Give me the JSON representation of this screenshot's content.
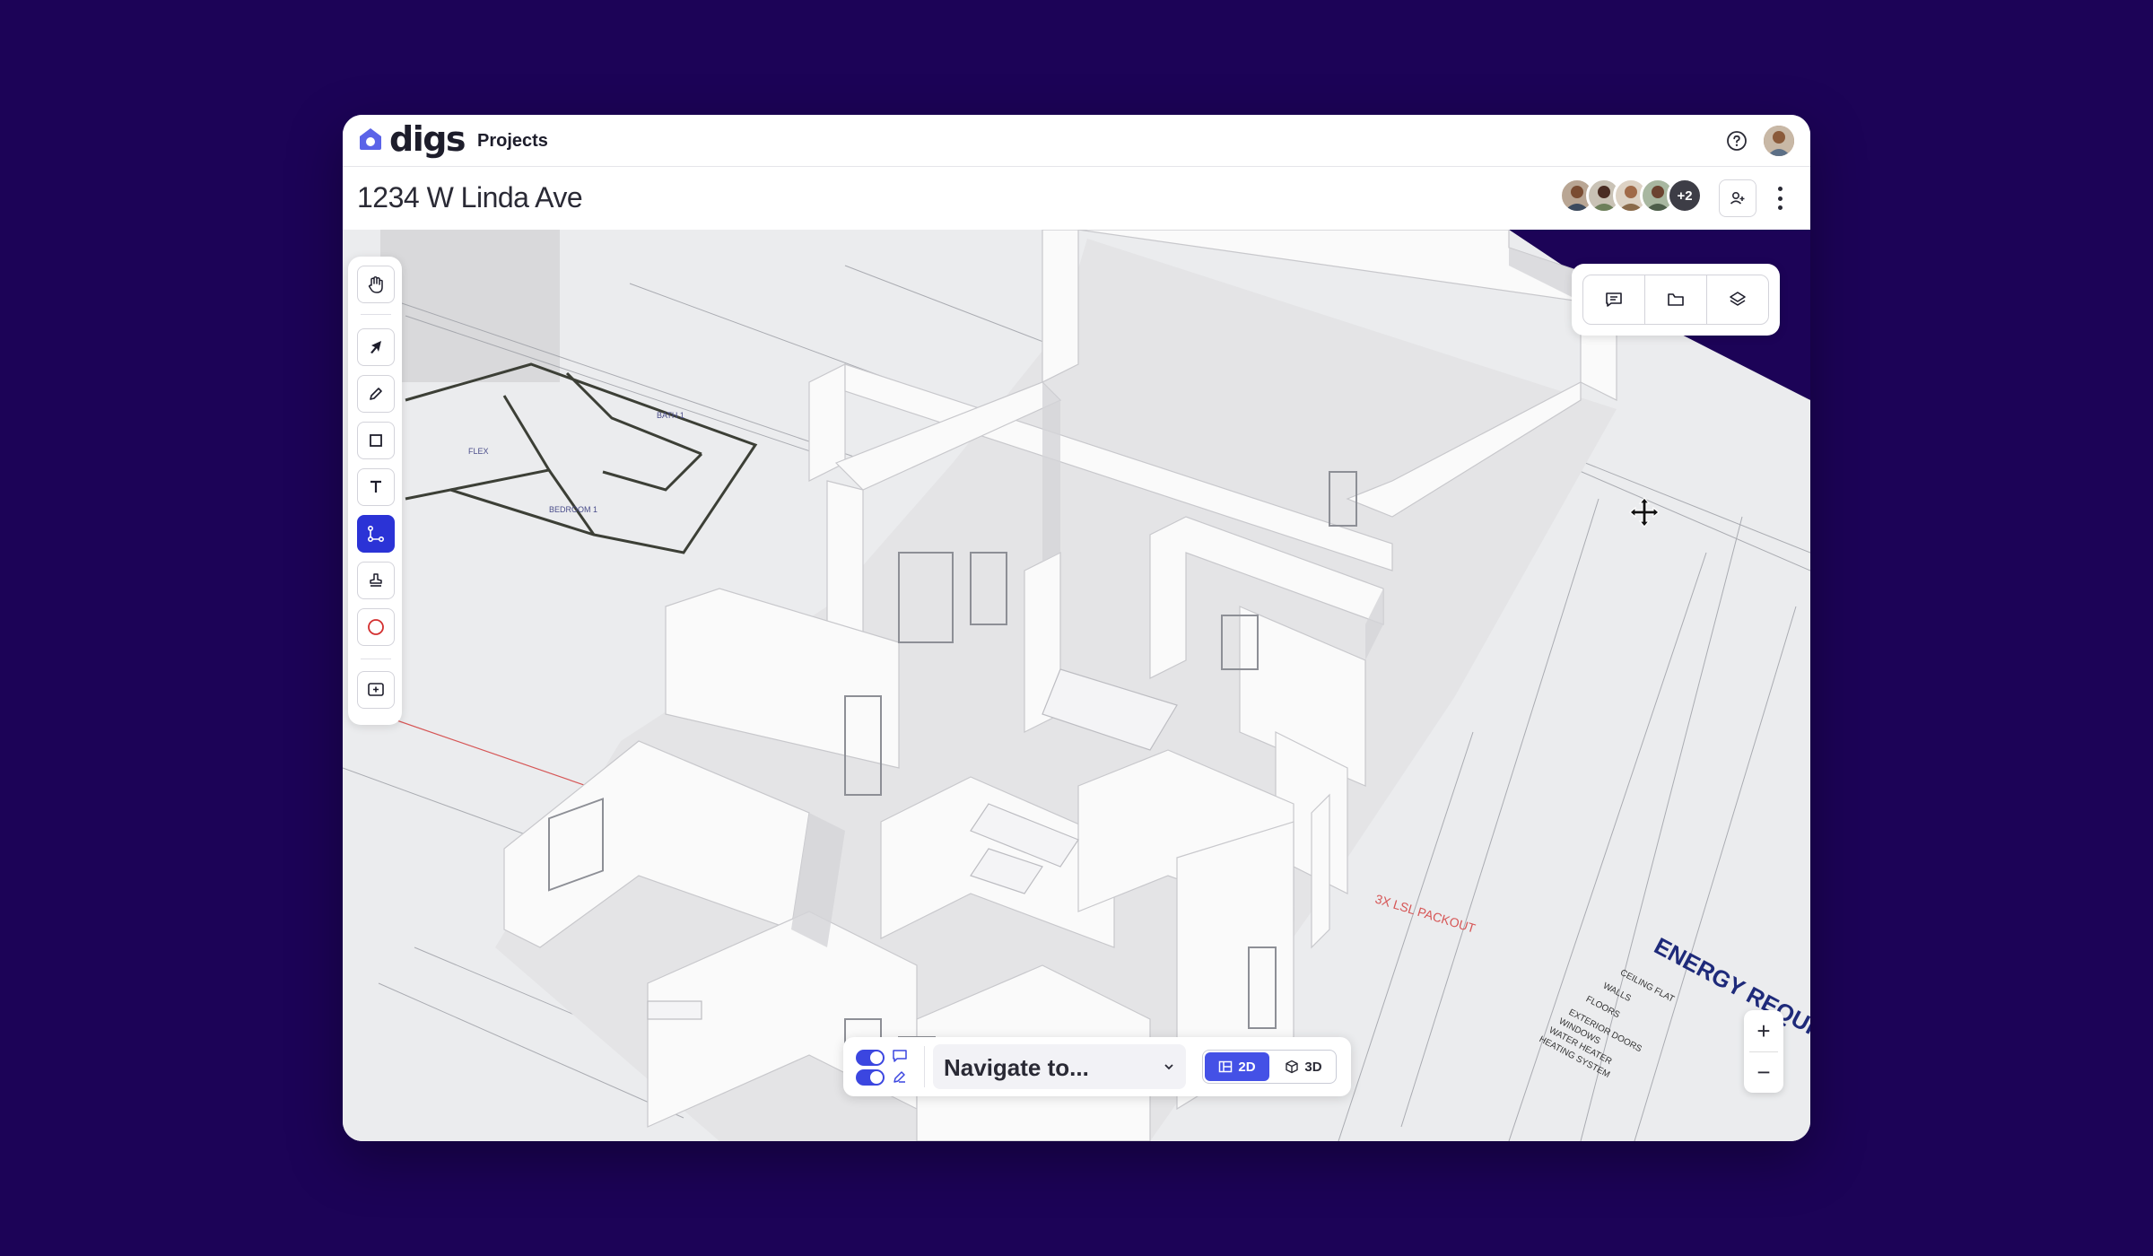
{
  "app": {
    "logo_text": "digs",
    "nav_projects": "Projects"
  },
  "header": {
    "title": "1234 W Linda Ave",
    "collaborators_more": "+2"
  },
  "toolbar": {
    "tools": [
      "hand",
      "pointer",
      "pencil",
      "rectangle",
      "text",
      "path",
      "stamp",
      "circle",
      "add-frame"
    ],
    "active_tool": "path"
  },
  "right_panel": {
    "buttons": [
      "comments",
      "files",
      "layers"
    ]
  },
  "zoom": {
    "in": "+",
    "out": "−"
  },
  "bottom_bar": {
    "navigate_value": "Navigate to...",
    "view_2d": "2D",
    "view_3d": "3D",
    "active_view": "2D"
  },
  "drawing": {
    "room_labels": [
      "FLEX",
      "BATH 1",
      "BEDROOM 1"
    ],
    "packout_note": "3X LSL PACKOUT",
    "energy_title": "ENERGY REQUIR",
    "energy_lines": [
      "CEILING FLAT",
      "WALLS",
      "FLOORS",
      "EXTERIOR DOORS",
      "WINDOWS",
      "WATER HEATER",
      "HEATING SYSTEM"
    ]
  },
  "colors": {
    "background": "#1c0357",
    "accent": "#2b33d6",
    "canvas": "#eeeff1"
  }
}
